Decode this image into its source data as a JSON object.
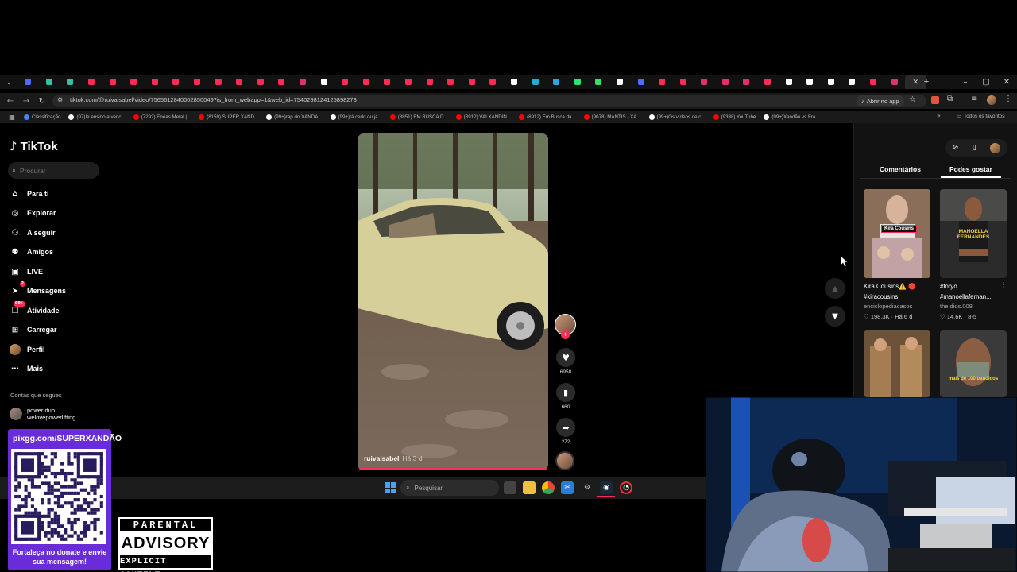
{
  "browser": {
    "url": "tiktok.com/@ruivaisabel/video/7565612840002850049?is_from_webapp=1&web_id=7540298124125898273",
    "open_in_app": "Abrir no app",
    "bookmarks": [
      {
        "label": "Classificação",
        "color": "#4285f4"
      },
      {
        "label": "(97)Ie ensino a venc...",
        "color": "#ffffff"
      },
      {
        "label": "(7292) Enéas Metal |...",
        "color": "#ff0000"
      },
      {
        "label": "(8159) SUPER XAND...",
        "color": "#ff0000"
      },
      {
        "label": "(99+)rap do XANDÃ...",
        "color": "#ffffff"
      },
      {
        "label": "(99+)tá cedo ou já...",
        "color": "#ffffff"
      },
      {
        "label": "(8851) EM BUSCA D...",
        "color": "#ff0000"
      },
      {
        "label": "(8912) VAI XANDIN...",
        "color": "#ff0000"
      },
      {
        "label": "(8912) Em Busca da...",
        "color": "#ff0000"
      },
      {
        "label": "(9078) MANTIS - XA...",
        "color": "#ff0000"
      },
      {
        "label": "(99+)Os vídeos de c...",
        "color": "#ffffff"
      },
      {
        "label": "(9338) YouTube",
        "color": "#ff0000"
      },
      {
        "label": "(99+)Xandão vs Fra...",
        "color": "#ffffff"
      }
    ],
    "all_favorites": "Todos os favoritos",
    "tab_colors": [
      "#4e6bff",
      "#34c3a0",
      "#34c3a0",
      "#ff2b55",
      "#ff2b55",
      "#ff2b55",
      "#ff2b55",
      "#ff2b55",
      "#ff2b55",
      "#ff2b55",
      "#ff2b55",
      "#ff2b55",
      "#ff2b55",
      "#e1306c",
      "#ffffff",
      "#ff2b55",
      "#ff2b55",
      "#ff2b55",
      "#ff2b55",
      "#ff2b55",
      "#ff2b55",
      "#ff2b55",
      "#ff2b55",
      "#ffffff",
      "#2aa7e0",
      "#2aa7e0",
      "#2ee46a",
      "#2ee46a",
      "#ffffff",
      "#4e6bff",
      "#ff2b55",
      "#ff2b55",
      "#e1306c",
      "#e1306c",
      "#e1306c",
      "#ff2b55",
      "#ffffff",
      "#ffffff",
      "#ffffff",
      "#ffffff",
      "#ff2b55",
      "#e1306c"
    ]
  },
  "tiktok": {
    "logo": "TikTok",
    "search_placeholder": "Procurar",
    "nav": [
      {
        "label": "Para ti",
        "icon": "home-icon"
      },
      {
        "label": "Explorar",
        "icon": "compass-icon"
      },
      {
        "label": "A seguir",
        "icon": "following-icon"
      },
      {
        "label": "Amigos",
        "icon": "friends-icon"
      },
      {
        "label": "LIVE",
        "icon": "live-icon"
      },
      {
        "label": "Mensagens",
        "icon": "messages-icon",
        "badge": "2"
      },
      {
        "label": "Atividade",
        "icon": "activity-icon",
        "badge": "99+"
      },
      {
        "label": "Carregar",
        "icon": "upload-icon"
      },
      {
        "label": "Perfil",
        "icon": "profile-icon"
      },
      {
        "label": "Mais",
        "icon": "more-icon"
      }
    ],
    "following_heading": "Contas que segues",
    "following": [
      {
        "name": "power duo",
        "handle": "welovepowerlifting"
      }
    ],
    "video": {
      "author": "ruivaisabel",
      "time": "Há 3 d",
      "likes": "6958",
      "saves": "660",
      "shares": "272"
    },
    "panel": {
      "tab_comments": "Comentários",
      "tab_suggested": "Podes gostar",
      "items": [
        {
          "title": "Kira Cousins⚠️ 🔴",
          "subtitle": "#kiracousins",
          "author": "enciclopediacasos",
          "likes": "198.3K",
          "age": "Há 6 d",
          "overlay": "Kira Cousins"
        },
        {
          "title": "#foryo",
          "subtitle": "#manoellafernan...",
          "author": "the.dios.008",
          "likes": "14.6K",
          "age": "8-5",
          "overlay": "MANOELLA FERNANDES"
        },
        {
          "overlay": ""
        },
        {
          "overlay": "mais de 100 bandidos"
        }
      ]
    }
  },
  "taskbar": {
    "search_placeholder": "Pesquisar"
  },
  "overlays": {
    "qr_url": "pixgg.com/SUPERXANDÃO",
    "qr_message": "Fortaleça no donate e envie sua mensagem!",
    "advisory_top": "PARENTAL",
    "advisory_mid": "ADVISORY",
    "advisory_bottom": "EXPLICIT CONTENT"
  }
}
